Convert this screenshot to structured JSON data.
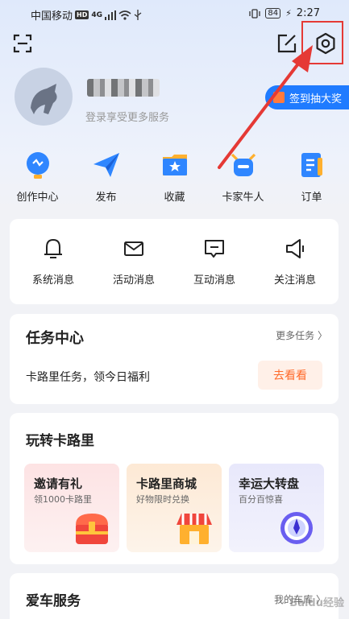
{
  "status_bar": {
    "carrier": "中国移动",
    "network": "HD",
    "signal": "4G",
    "battery": "84",
    "time": "2:27"
  },
  "icons": {
    "scan": "scan-icon",
    "edit": "edit-icon",
    "settings": "settings-icon"
  },
  "colors": {
    "accent": "#1f7bff",
    "highlight": "#e53935",
    "orange": "#ff6a2a"
  },
  "profile": {
    "login_hint": "登录享受更多服务",
    "signin_button": "签到抽大奖"
  },
  "quick_actions": [
    {
      "label": "创作中心",
      "icon": "bulb-icon"
    },
    {
      "label": "发布",
      "icon": "paper-plane-icon"
    },
    {
      "label": "收藏",
      "icon": "star-folder-icon"
    },
    {
      "label": "卡家牛人",
      "icon": "bull-icon"
    },
    {
      "label": "订单",
      "icon": "order-icon"
    }
  ],
  "messages": [
    {
      "label": "系统消息",
      "icon": "bell-icon"
    },
    {
      "label": "活动消息",
      "icon": "envelope-icon"
    },
    {
      "label": "互动消息",
      "icon": "chat-icon"
    },
    {
      "label": "关注消息",
      "icon": "megaphone-icon"
    }
  ],
  "task_center": {
    "title": "任务中心",
    "more": "更多任务 〉",
    "description": "卡路里任务，领今日福利",
    "button": "去看看"
  },
  "play": {
    "title": "玩转卡路里",
    "tiles": [
      {
        "title": "邀请有礼",
        "subtitle": "领1000卡路里",
        "icon": "treasure-chest-icon",
        "bg": "#fde9ea"
      },
      {
        "title": "卡路里商城",
        "subtitle": "好物限时兑换",
        "icon": "shop-icon",
        "bg": "#fdf0e0"
      },
      {
        "title": "幸运大转盘",
        "subtitle": "百分百惊喜",
        "icon": "wheel-icon",
        "bg": "#eeedfb"
      }
    ]
  },
  "car_service": {
    "title": "爱车服务",
    "more": "我的车库 〉"
  }
}
